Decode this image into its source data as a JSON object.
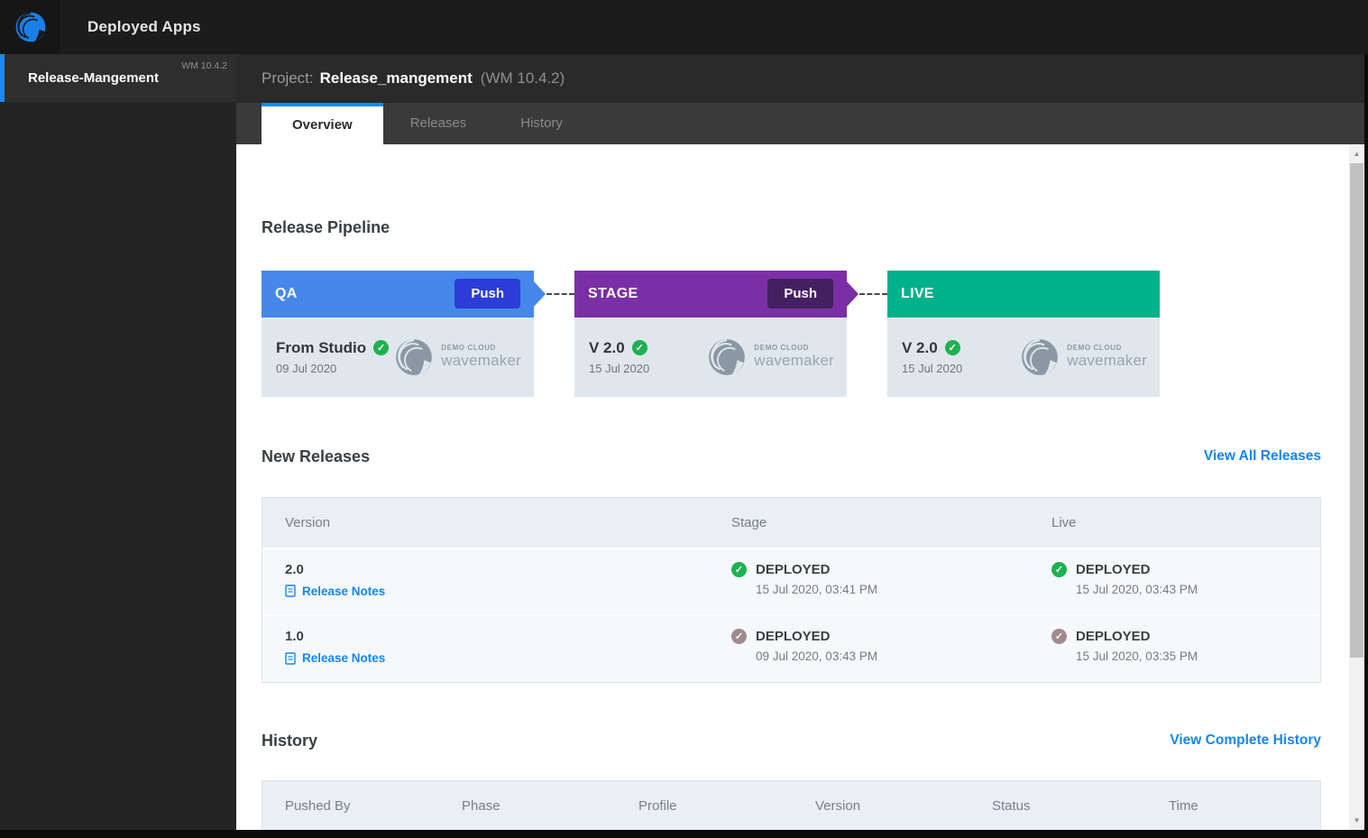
{
  "topbar": {
    "title": "Deployed Apps"
  },
  "sidebar": {
    "item": {
      "label": "Release-Mangement",
      "version": "WM 10.4.2"
    }
  },
  "project_header": {
    "label": "Project:",
    "name": "Release_mangement",
    "version": "(WM 10.4.2)"
  },
  "tabs": [
    {
      "label": "Overview",
      "active": true
    },
    {
      "label": "Releases",
      "active": false
    },
    {
      "label": "History",
      "active": false
    }
  ],
  "colors": {
    "qa_header": "#4687ec",
    "qa_push": "#2c3cd6",
    "stage_header": "#7b2fa6",
    "stage_push": "#432060",
    "live_header": "#00b189",
    "check_green": "#1fb150",
    "check_brown": "#a18a8a",
    "link_blue": "#1486f0",
    "tab_accent": "#0d8bf2"
  },
  "pipeline": {
    "title": "Release Pipeline",
    "stages": [
      {
        "name": "QA",
        "push_label": "Push",
        "version": "From Studio",
        "date": "09 Jul 2020"
      },
      {
        "name": "STAGE",
        "push_label": "Push",
        "version": "V 2.0",
        "date": "15 Jul 2020"
      },
      {
        "name": "LIVE",
        "version": "V 2.0",
        "date": "15 Jul 2020"
      }
    ],
    "logo": {
      "line1": "DEMO CLOUD",
      "line2": "wavemaker"
    }
  },
  "new_releases": {
    "title": "New Releases",
    "view_all_label": "View All Releases",
    "columns": [
      "Version",
      "Stage",
      "Live"
    ],
    "rows": [
      {
        "version": "2.0",
        "notes_label": "Release Notes",
        "stage": {
          "status": "DEPLOYED",
          "time": "15 Jul 2020, 03:41 PM",
          "check_color": "#1fb150"
        },
        "live": {
          "status": "DEPLOYED",
          "time": "15 Jul 2020, 03:43 PM",
          "check_color": "#1fb150"
        }
      },
      {
        "version": "1.0",
        "notes_label": "Release Notes",
        "stage": {
          "status": "DEPLOYED",
          "time": "09 Jul 2020, 03:43 PM",
          "check_color": "#a18a8a"
        },
        "live": {
          "status": "DEPLOYED",
          "time": "15 Jul 2020, 03:35 PM",
          "check_color": "#a18a8a"
        }
      }
    ]
  },
  "history": {
    "title": "History",
    "view_all_label": "View Complete History",
    "columns": [
      "Pushed By",
      "Phase",
      "Profile",
      "Version",
      "Status",
      "Time"
    ]
  },
  "glyphs": {
    "check": "✓",
    "up_arrow": "▲",
    "down_arrow": "▼"
  }
}
